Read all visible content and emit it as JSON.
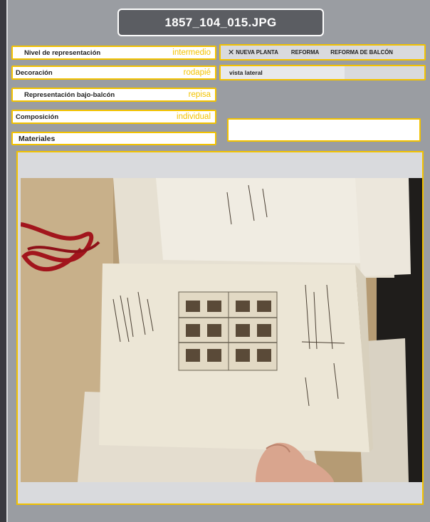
{
  "header": {
    "title": "1857_104_015.JPG"
  },
  "fields": {
    "nivel": {
      "label": "Nivel de representación",
      "value": "intermedio"
    },
    "decoracion": {
      "label": "Decoración",
      "value": "rodapié"
    },
    "representacion": {
      "label": "Representación bajo-balcón",
      "value": "repisa"
    },
    "composicion": {
      "label": "Composición",
      "value": "individual"
    },
    "materiales": {
      "label": "Materiales"
    }
  },
  "tags": {
    "close_symbol": "✕",
    "items": [
      "NUEVA PLANTA",
      "REFORMA",
      "REFORMA DE BALCÓN"
    ]
  },
  "vista": {
    "label": "vista lateral"
  },
  "colors": {
    "accent": "#f2c200",
    "panel": "#9a9da2",
    "title_bg": "#5b5d62"
  }
}
